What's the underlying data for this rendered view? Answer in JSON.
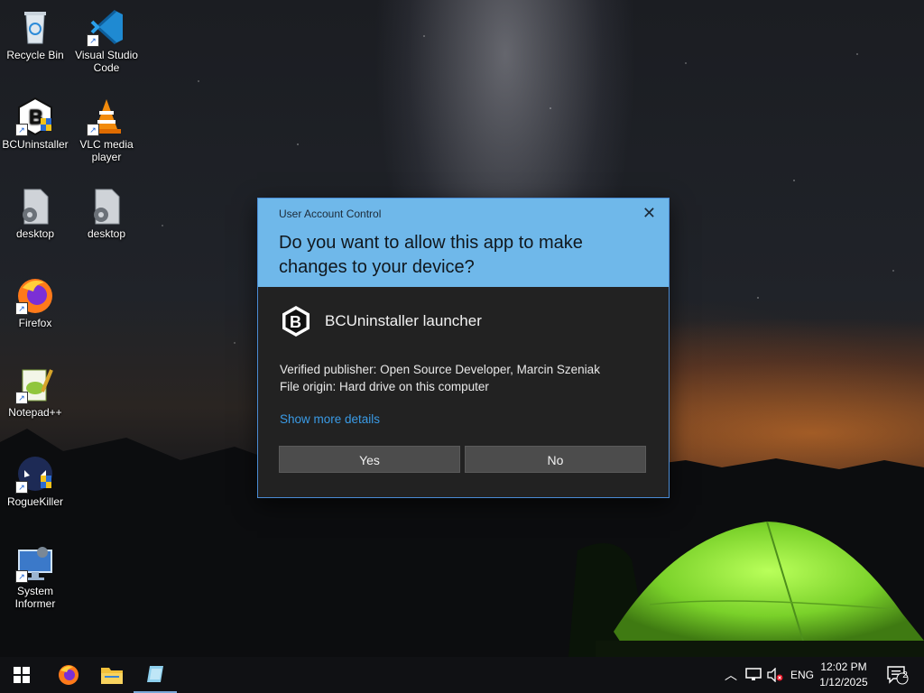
{
  "desktop": {
    "icons": [
      {
        "label": "Recycle Bin",
        "icon": "recycle-bin-icon"
      },
      {
        "label": "Visual Studio Code",
        "icon": "vscode-icon"
      },
      {
        "label": "BCUninstaller",
        "icon": "bcuninstaller-icon"
      },
      {
        "label": "VLC media player",
        "icon": "vlc-icon"
      },
      {
        "label": "desktop",
        "icon": "settings-file-icon"
      },
      {
        "label": "desktop",
        "icon": "settings-file-icon"
      },
      {
        "label": "Firefox",
        "icon": "firefox-icon"
      },
      {
        "label": "Notepad++",
        "icon": "notepadpp-icon"
      },
      {
        "label": "RogueKiller",
        "icon": "roguekiller-icon"
      },
      {
        "label": "System Informer",
        "icon": "system-informer-icon"
      }
    ]
  },
  "uac": {
    "title": "User Account Control",
    "close_glyph": "✕",
    "question": "Do you want to allow this app to make changes to your device?",
    "app_name": "BCUninstaller launcher",
    "publisher_line": "Verified publisher: Open Source Developer, Marcin Szeniak",
    "origin_line": "File origin: Hard drive on this computer",
    "details_link": "Show more details",
    "yes_label": "Yes",
    "no_label": "No",
    "accent_color": "#6fb8ea",
    "body_color": "#222222"
  },
  "taskbar": {
    "items": [
      "start-button",
      "firefox",
      "file-explorer",
      "uac-app"
    ],
    "tray": {
      "language": "ENG",
      "time": "12:02 PM",
      "date": "1/12/2025",
      "notification_count": "2"
    }
  }
}
